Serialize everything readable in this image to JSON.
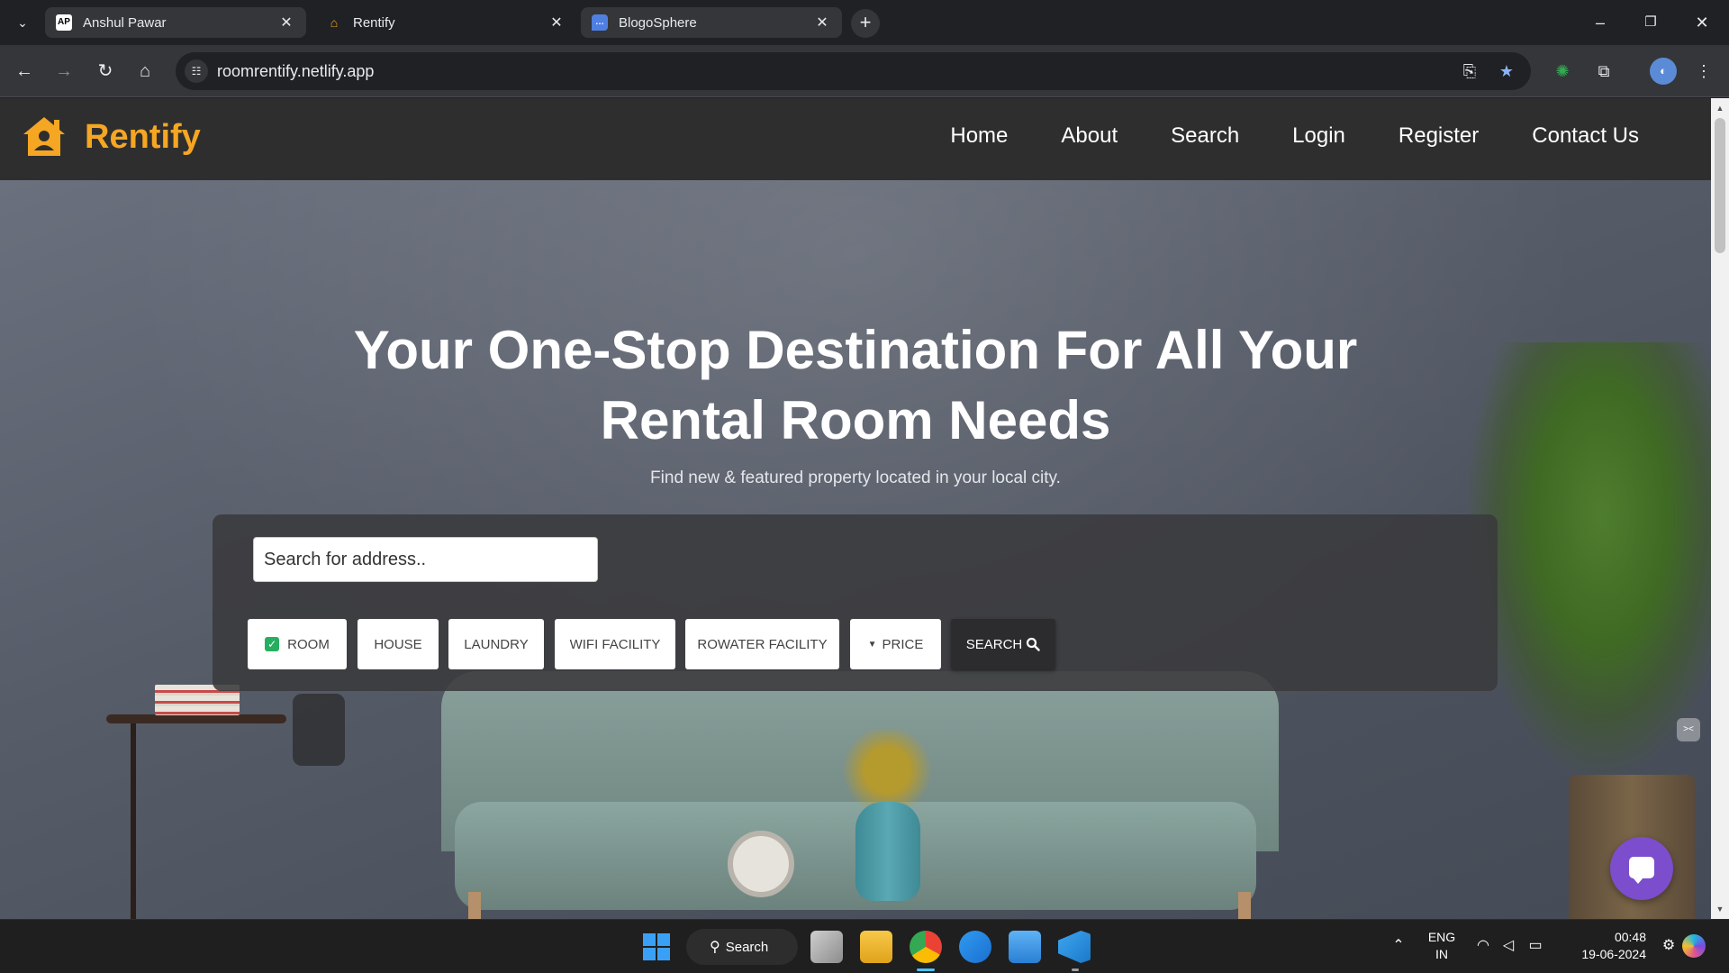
{
  "browser": {
    "tabs": [
      {
        "label": "Anshul Pawar",
        "favicon": "AP",
        "active": true
      },
      {
        "label": "Rentify",
        "favicon": "house-favicon",
        "active": false
      },
      {
        "label": "BlogoSphere",
        "favicon": "chat-favicon",
        "active": false
      }
    ],
    "url": "roomrentify.netlify.app"
  },
  "site": {
    "brand": "Rentify",
    "brand_color": "#f5a623",
    "nav": [
      "Home",
      "About",
      "Search",
      "Login",
      "Register",
      "Contact Us"
    ]
  },
  "hero": {
    "title_line1": "Your One-Stop Destination For All Your",
    "title_line2": "Rental Room Needs",
    "subtitle": "Find new & featured property located in your local city."
  },
  "search": {
    "placeholder": "Search for address..",
    "filters": [
      {
        "label": "ROOM",
        "checked": true
      },
      {
        "label": "HOUSE",
        "checked": false
      },
      {
        "label": "LAUNDRY",
        "checked": false
      },
      {
        "label": "WIFI FACILITY",
        "checked": false
      },
      {
        "label": "ROWATER FACILITY",
        "checked": false
      }
    ],
    "price_label": "PRICE",
    "button_label": "SEARCH"
  },
  "taskbar": {
    "search_label": "Search",
    "lang_line1": "ENG",
    "lang_line2": "IN",
    "time": "00:48",
    "date": "19-06-2024"
  }
}
